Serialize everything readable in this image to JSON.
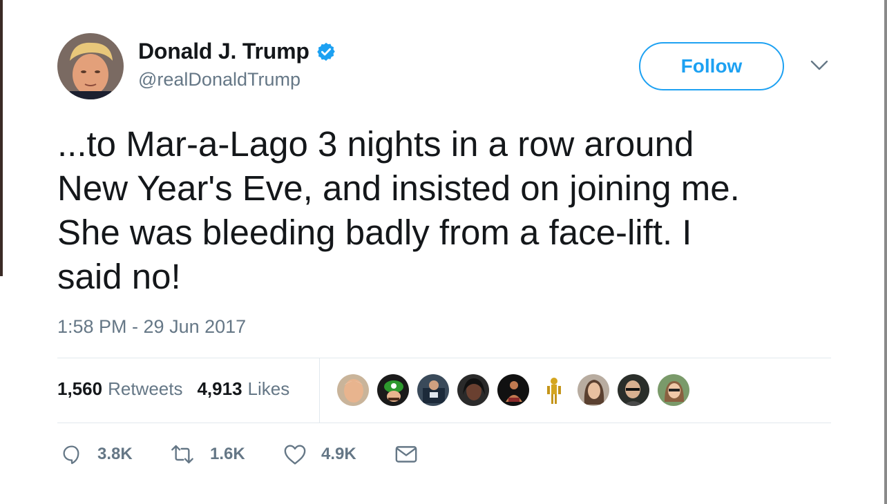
{
  "author": {
    "display_name": "Donald J. Trump",
    "handle": "@realDonaldTrump",
    "verified": true
  },
  "follow_button": {
    "label": "Follow"
  },
  "tweet": {
    "text": "...to Mar-a-Lago 3 nights in a row around\nNew Year's Eve, and insisted on joining me.\nShe was bleeding badly from a face-lift. I\nsaid no!",
    "timestamp": "1:58 PM - 29 Jun 2017"
  },
  "stats": {
    "retweets_count": "1,560",
    "retweets_label": "Retweets",
    "likes_count": "4,913",
    "likes_label": "Likes"
  },
  "actions": {
    "reply_count": "3.8K",
    "retweet_count": "1.6K",
    "like_count": "4.9K"
  },
  "icons": {
    "verified": "verified-badge-icon",
    "caret": "chevron-down-icon",
    "reply": "reply-icon",
    "retweet": "retweet-icon",
    "like": "heart-icon",
    "message": "envelope-icon"
  },
  "colors": {
    "accent": "#1da1f2",
    "text_primary": "#14171a",
    "text_secondary": "#657786",
    "divider": "#e1e8ed"
  }
}
